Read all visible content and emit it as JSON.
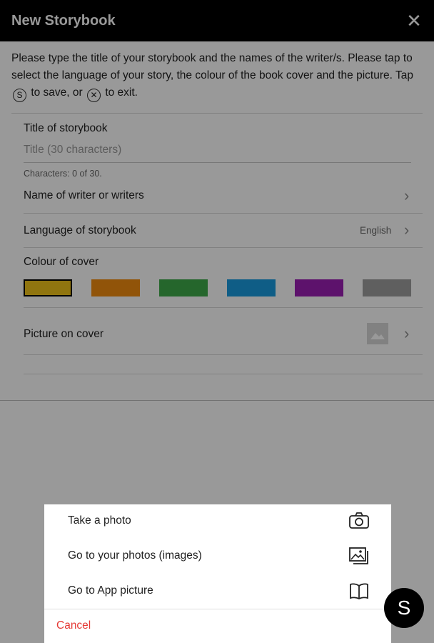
{
  "header": {
    "title": "New Storybook",
    "close_icon": "close-icon"
  },
  "instructions": {
    "line1": "Please type the title of your storybook and the names of the writer/s. Please tap to select the language of your story, the colour of the book cover and the picture.",
    "tap": "Tap",
    "save_glyph": "S",
    "to_save_or": "to save, or",
    "exit_glyph": "✕",
    "to_exit": "to exit."
  },
  "form": {
    "title_label": "Title of storybook",
    "title_placeholder": "Title (30 characters)",
    "char_count": "Characters: 0 of 30.",
    "writers_label": "Name of writer or writers",
    "language_label": "Language of storybook",
    "language_value": "English",
    "colour_label": "Colour of cover",
    "picture_label": "Picture on cover"
  },
  "colours": [
    "#f0c419",
    "#f28c0f",
    "#3faa4a",
    "#1a9be0",
    "#9c1fb5",
    "#9e9e9e"
  ],
  "selected_colour_index": 0,
  "sheet": {
    "items": [
      {
        "label": "Take a photo",
        "icon": "camera-icon"
      },
      {
        "label": "Go to your photos (images)",
        "icon": "gallery-icon"
      },
      {
        "label": "Go to App picture",
        "icon": "book-icon"
      }
    ],
    "cancel": "Cancel"
  },
  "fab": {
    "label": "S"
  }
}
